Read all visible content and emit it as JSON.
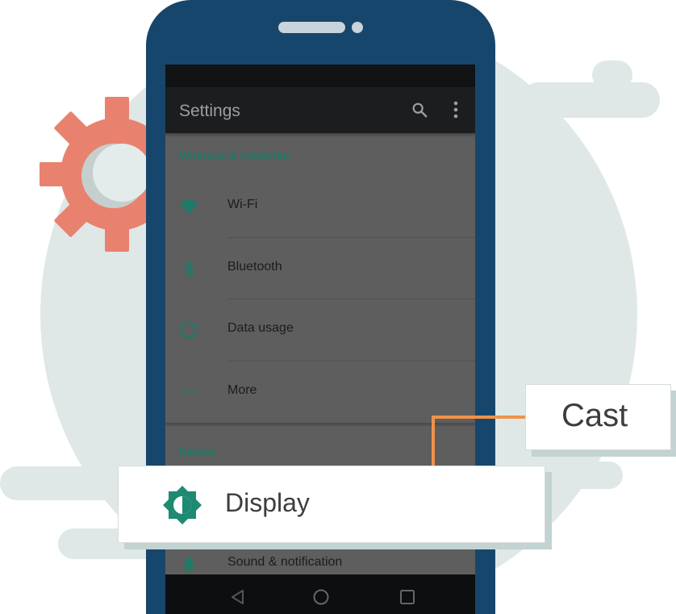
{
  "app_bar": {
    "title": "Settings",
    "search_icon": "search-icon",
    "more_icon": "more-vert-icon"
  },
  "sections": [
    {
      "header": "Wireless & networks",
      "items": [
        {
          "label": "Wi-Fi",
          "icon": "wifi-icon"
        },
        {
          "label": "Bluetooth",
          "icon": "bluetooth-icon"
        },
        {
          "label": "Data usage",
          "icon": "data-usage-icon"
        },
        {
          "label": "More",
          "icon": "more-horiz-icon"
        }
      ]
    },
    {
      "header": "Device",
      "items": [
        {
          "label": "Sound & notification",
          "icon": "bell-icon"
        }
      ]
    }
  ],
  "callouts": {
    "display_label": "Display",
    "display_icon": "brightness-icon",
    "cast_label": "Cast"
  },
  "colors": {
    "accent": "#1f7a67",
    "phone_body": "#17466c",
    "gear": "#e8826e",
    "arrow": "#f0924a",
    "background_blob": "#dfe8e7"
  }
}
